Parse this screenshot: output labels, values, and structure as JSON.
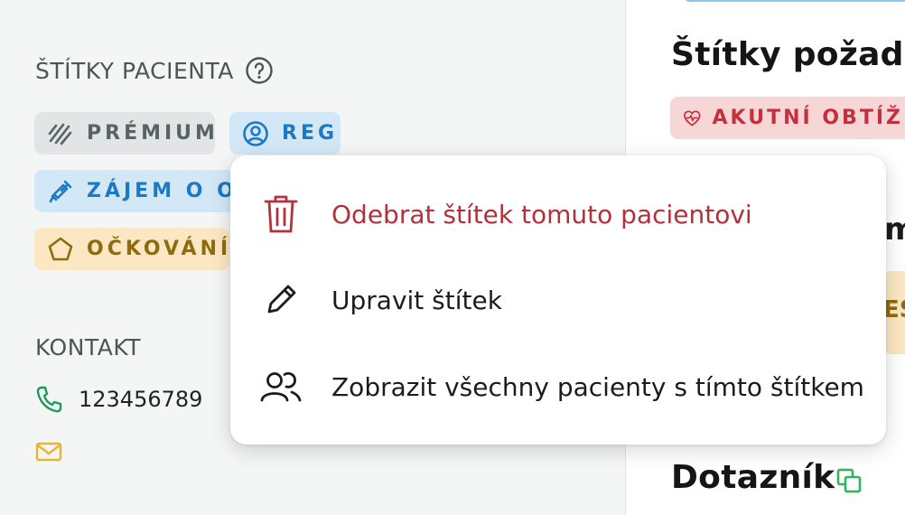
{
  "patient_tags": {
    "title": "ŠTÍTKY PACIENTA",
    "tags": [
      {
        "label": "PRÉMIUM",
        "icon": "premium-icon",
        "color": "#5a6363"
      },
      {
        "label": "REG",
        "icon": "user-circle-icon",
        "color": "#1d79c4"
      },
      {
        "label": "ZÁJEM O OČ",
        "icon": "syringe-icon",
        "color": "#1d79c4"
      },
      {
        "label": "OČKOVÁNÍ",
        "icon": "pentagon-icon",
        "color": "#8f6a10"
      }
    ]
  },
  "contact": {
    "title": "KONTAKT",
    "phone": "123456789",
    "email": ""
  },
  "right": {
    "request_tags_title": "Štítky požadav",
    "akutni_label": "AKUTNÍ OBTÍŽE",
    "partial_heading_char": "m",
    "partial_yellow_char": "ES",
    "questionnaire_title": "Dotazník"
  },
  "context_menu": {
    "items": [
      {
        "label": "Odebrat štítek tomuto pacientovi",
        "icon": "trash-icon",
        "danger": true
      },
      {
        "label": "Upravit štítek",
        "icon": "pencil-icon",
        "danger": false
      },
      {
        "label": "Zobrazit všechny pacienty s tímto štítkem",
        "icon": "users-icon",
        "danger": false
      }
    ]
  },
  "colors": {
    "danger": "#b3313a",
    "accent_blue": "#1d79c4",
    "phone_green": "#1f9a5a",
    "mail_yellow": "#e8b532",
    "copy_green": "#2fb35b"
  }
}
